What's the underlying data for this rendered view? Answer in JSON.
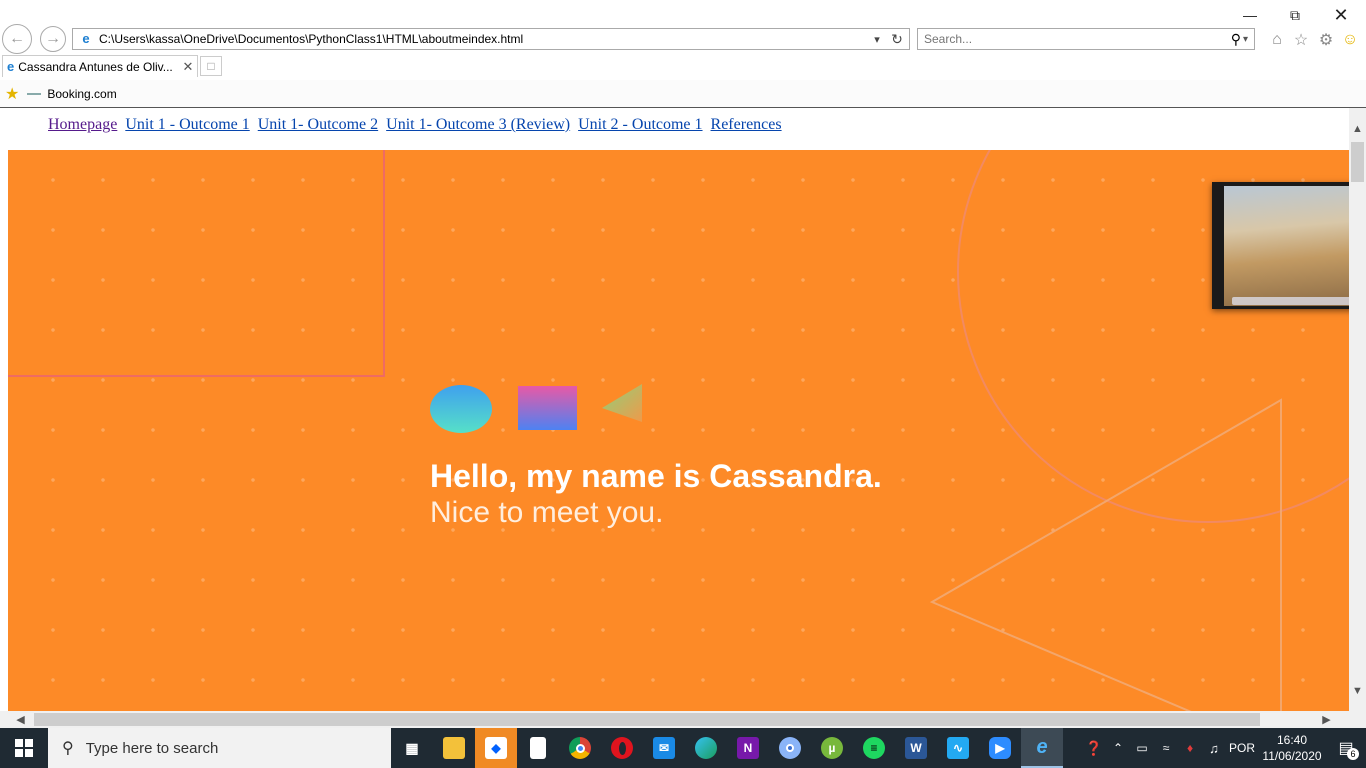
{
  "browser": {
    "address": "C:\\Users\\kassa\\OneDrive\\Documentos\\PythonClass1\\HTML\\aboutmeindex.html",
    "search_placeholder": "Search...",
    "tab_title": "Cassandra Antunes de Oliv...",
    "favorites": [
      "Booking.com"
    ]
  },
  "nav": {
    "links": [
      "Homepage",
      "Unit 1 - Outcome 1",
      "Unit 1- Outcome 2",
      "Unit 1- Outcome 3 (Review)",
      "Unit 2 - Outcome 1",
      "References"
    ]
  },
  "hero": {
    "title": "Hello, my name is Cassandra.",
    "subtitle": "Nice to meet you.",
    "background_color": "#fd8a27"
  },
  "taskbar": {
    "search_placeholder": "Type here to search",
    "apps": [
      "task-view",
      "file-explorer",
      "dropbox",
      "notepad",
      "chrome",
      "opera",
      "mail",
      "edge",
      "onenote",
      "chromium",
      "utorrent",
      "spotify",
      "word",
      "vscode",
      "zoom",
      "internet-explorer"
    ],
    "language": "POR",
    "time": "16:40",
    "date": "11/06/2020",
    "notification_count": "6"
  }
}
